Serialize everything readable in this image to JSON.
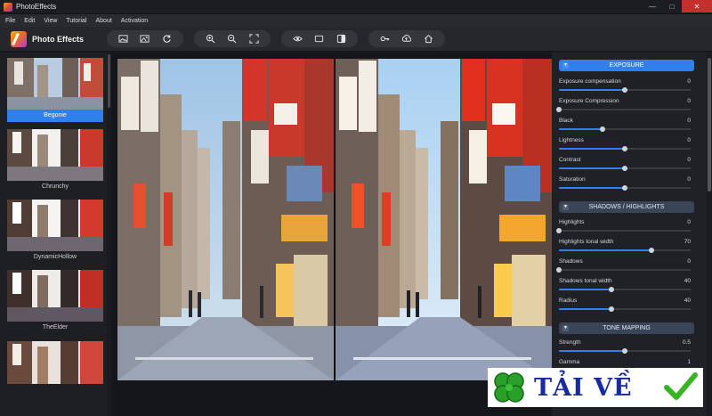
{
  "window": {
    "title": "PhotoEffects"
  },
  "menu": [
    "File",
    "Edit",
    "View",
    "Tutorial",
    "About",
    "Activation"
  ],
  "toolbar": {
    "app_name": "Photo Effects",
    "groups": [
      [
        "open-image-icon",
        "save-image-icon",
        "rotate-icon"
      ],
      [
        "zoom-in-icon",
        "zoom-out-icon",
        "fit-screen-icon"
      ],
      [
        "eye-icon",
        "single-view-icon",
        "split-view-icon"
      ],
      [
        "key-icon",
        "upload-icon",
        "home-icon"
      ]
    ]
  },
  "presets": [
    {
      "label": "Begonie",
      "active": true
    },
    {
      "label": "Chrunchy",
      "active": false
    },
    {
      "label": "DynamicHollow",
      "active": false
    },
    {
      "label": "TheElder",
      "active": false
    },
    {
      "label": "",
      "active": false
    }
  ],
  "panel": {
    "sections": {
      "exposure": {
        "title": "EXPOSURE",
        "params": [
          {
            "name": "Exposure compensation",
            "value": "0",
            "level": 0.5
          },
          {
            "name": "Exposure Compression",
            "value": "0",
            "level": 0.0
          },
          {
            "name": "Black",
            "value": "0",
            "level": 0.33
          },
          {
            "name": "Lightness",
            "value": "0",
            "level": 0.5
          },
          {
            "name": "Contrast",
            "value": "0",
            "level": 0.5
          },
          {
            "name": "Saturation",
            "value": "0",
            "level": 0.5
          }
        ]
      },
      "shadows": {
        "title": "SHADOWS / HIGHLIGHTS",
        "params": [
          {
            "name": "Highlights",
            "value": "0",
            "level": 0.0
          },
          {
            "name": "Highlights tonal width",
            "value": "70",
            "level": 0.7
          },
          {
            "name": "Shadows",
            "value": "0",
            "level": 0.0
          },
          {
            "name": "Shadows tonal width",
            "value": "40",
            "level": 0.4
          },
          {
            "name": "Radius",
            "value": "40",
            "level": 0.4
          }
        ]
      },
      "tone": {
        "title": "TONE MAPPING",
        "params": [
          {
            "name": "Strength",
            "value": "0.5",
            "level": 0.5
          },
          {
            "name": "Gamma",
            "value": "1",
            "level": 0.5
          }
        ]
      }
    }
  },
  "watermark": {
    "text": "TẢI VỀ"
  },
  "colors": {
    "accent": "#2f80ed",
    "background": "#1b1c1f",
    "close": "#c4302b"
  }
}
